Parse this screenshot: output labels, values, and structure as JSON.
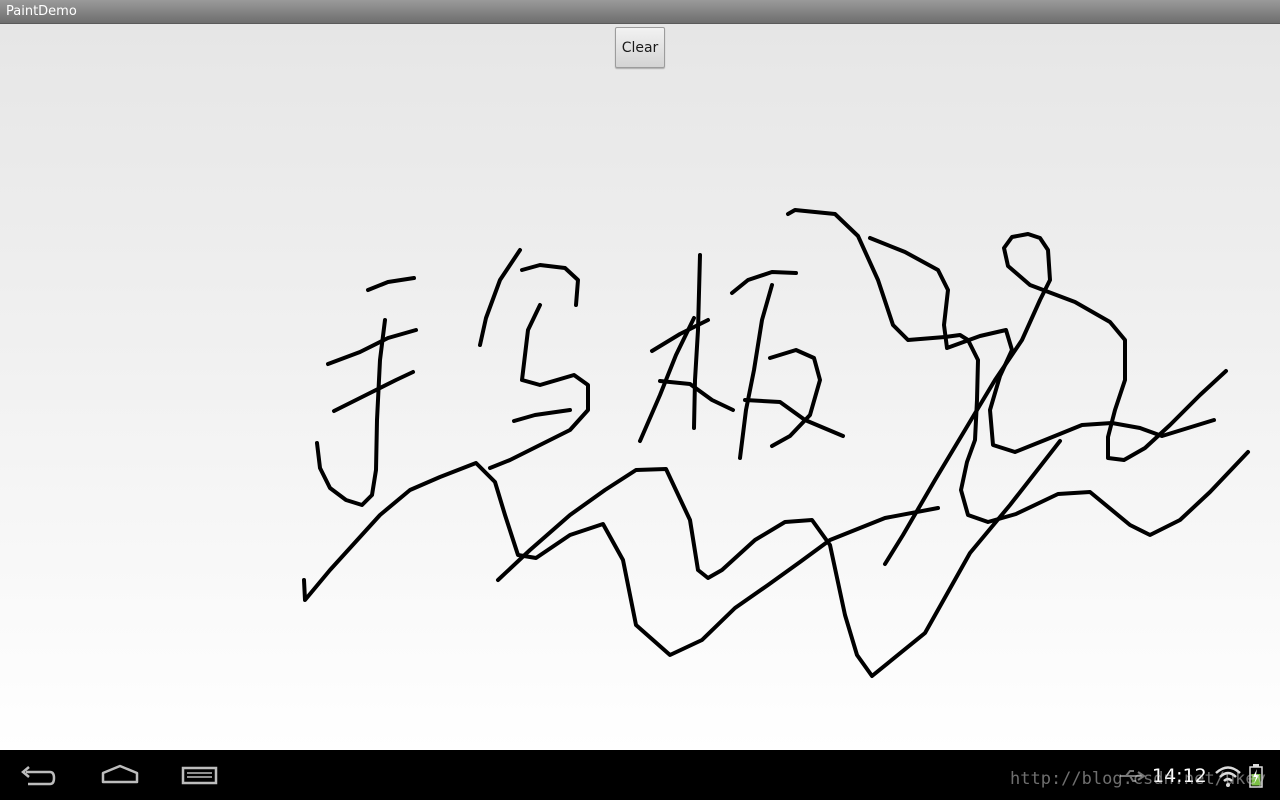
{
  "app": {
    "title": "PaintDemo"
  },
  "toolbar": {
    "clear_label": "Clear"
  },
  "colors": {
    "stroke": "#000000",
    "canvas_top": "#e6e6e6",
    "canvas_bottom": "#ffffff",
    "titlebar": "#808080",
    "navbar": "#000000"
  },
  "navigation": {
    "back_icon": "back-icon",
    "home_icon": "home-icon",
    "recent_icon": "recent-apps-icon"
  },
  "status": {
    "time": "14:12",
    "usb_icon": "usb-icon",
    "wifi_icon": "wifi-icon",
    "battery_icon": "battery-charging-icon"
  },
  "watermark": {
    "text": "http://blog.csdn.net/ukey"
  }
}
